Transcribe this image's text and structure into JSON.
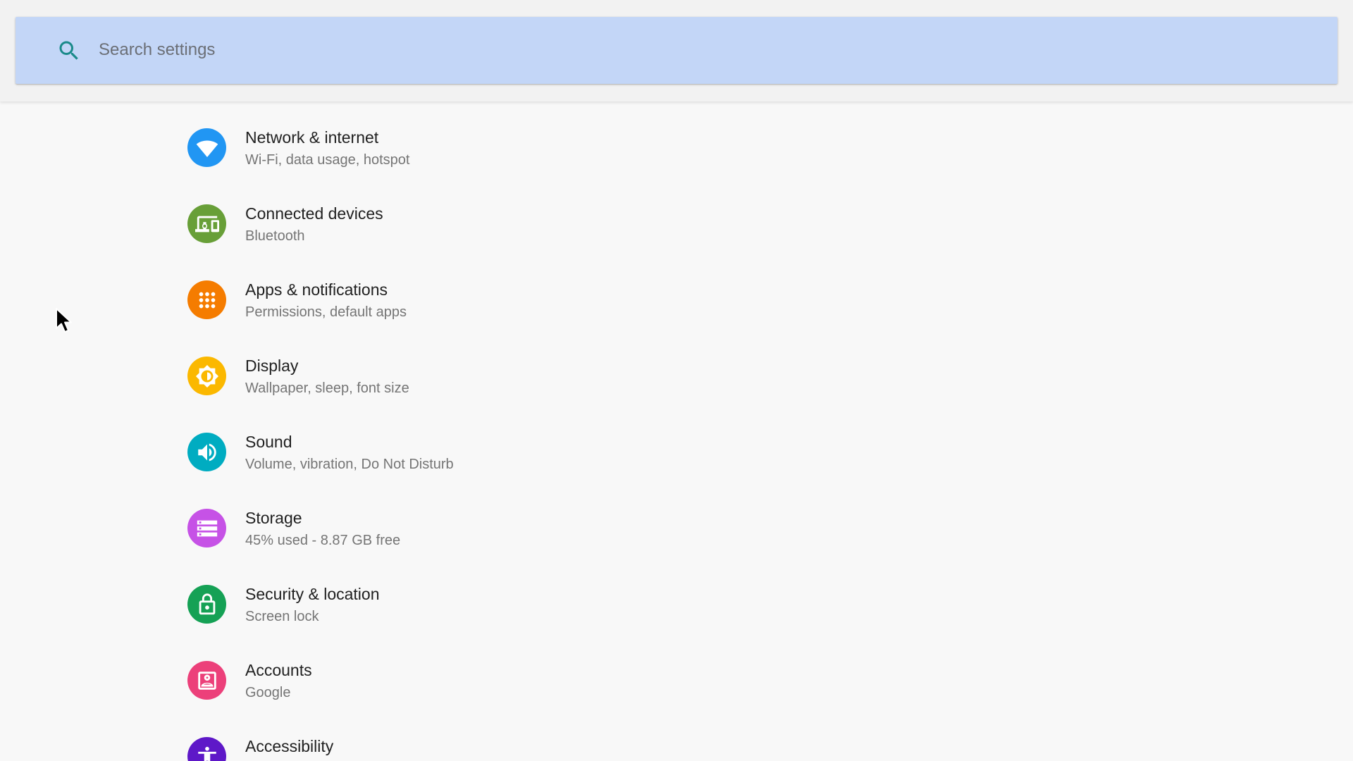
{
  "search": {
    "placeholder": "Search settings",
    "value": ""
  },
  "settings": [
    {
      "title": "Network & internet",
      "summary": "Wi-Fi, data usage, hotspot",
      "icon": "wifi-icon",
      "color": "#2196f3"
    },
    {
      "title": "Connected devices",
      "summary": "Bluetooth",
      "icon": "devices-icon",
      "color": "#689f38"
    },
    {
      "title": "Apps & notifications",
      "summary": "Permissions, default apps",
      "icon": "apps-icon",
      "color": "#f57c00"
    },
    {
      "title": "Display",
      "summary": "Wallpaper, sleep, font size",
      "icon": "brightness-icon",
      "color": "#fbb800"
    },
    {
      "title": "Sound",
      "summary": "Volume, vibration, Do Not Disturb",
      "icon": "volume-icon",
      "color": "#00acc1"
    },
    {
      "title": "Storage",
      "summary": "45% used - 8.87 GB free",
      "icon": "storage-icon",
      "color": "#c652e6"
    },
    {
      "title": "Security & location",
      "summary": "Screen lock",
      "icon": "lock-icon",
      "color": "#15a155"
    },
    {
      "title": "Accounts",
      "summary": "Google",
      "icon": "account-icon",
      "color": "#ec407a"
    },
    {
      "title": "Accessibility",
      "summary": "",
      "icon": "accessibility-icon",
      "color": "#5e18c8"
    }
  ]
}
